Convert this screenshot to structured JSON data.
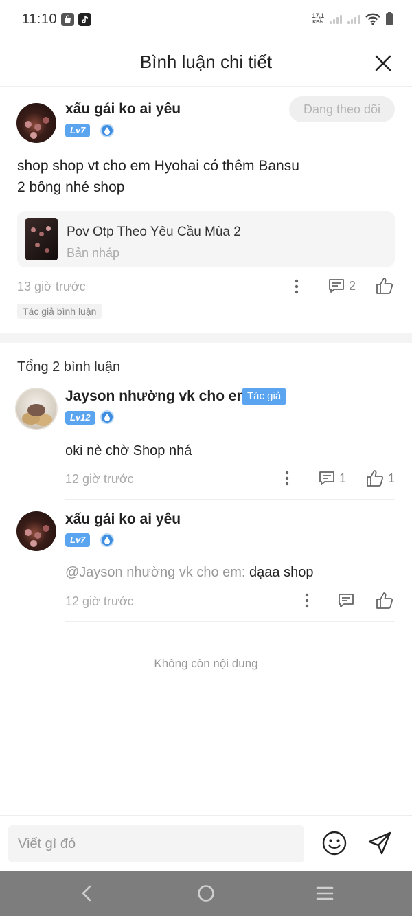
{
  "status_bar": {
    "time": "11:10",
    "net_speed_value": "17,1",
    "net_speed_unit": "KB/s"
  },
  "header": {
    "title": "Bình luận chi tiết"
  },
  "main_comment": {
    "user_name": "xấu gái ko ai yêu",
    "level": "Lv7",
    "follow_label": "Đang theo dõi",
    "text_line1": "shop shop vt cho em Hyohai có thêm Bansu",
    "text_line2": "2 bông nhé shop",
    "linked_story": {
      "title": "Pov Otp Theo Yêu Cầu Mùa 2",
      "status": "Bản nháp"
    },
    "time": "13 giờ trước",
    "reply_count": "2",
    "author_tag": "Tác giả bình luận"
  },
  "replies_section": {
    "total_label": "Tổng 2 bình luận",
    "replies": [
      {
        "user_name": "Jayson nhường vk cho em",
        "author_chip": "Tác giả",
        "level": "Lv12",
        "text": "oki nè chờ Shop nhá",
        "time": "12 giờ trước",
        "reply_count": "1",
        "like_count": "1"
      },
      {
        "user_name": "xấu gái ko ai yêu",
        "level": "Lv7",
        "mention": "@Jayson nhường vk cho em: ",
        "text": "dạaa shop",
        "time": "12 giờ trước"
      }
    ],
    "end_text": "Không còn nội dung"
  },
  "input_bar": {
    "placeholder": "Viết gì đó"
  },
  "colors": {
    "accent": "#5aa4f0",
    "muted_text": "#aaaaaa",
    "nav_bar": "#7d7d7d"
  },
  "icons": [
    "close-icon",
    "more-icon",
    "comment-icon",
    "like-icon",
    "emoji-icon",
    "send-icon",
    "back-icon",
    "home-icon",
    "menu-icon",
    "water-drop-icon"
  ]
}
